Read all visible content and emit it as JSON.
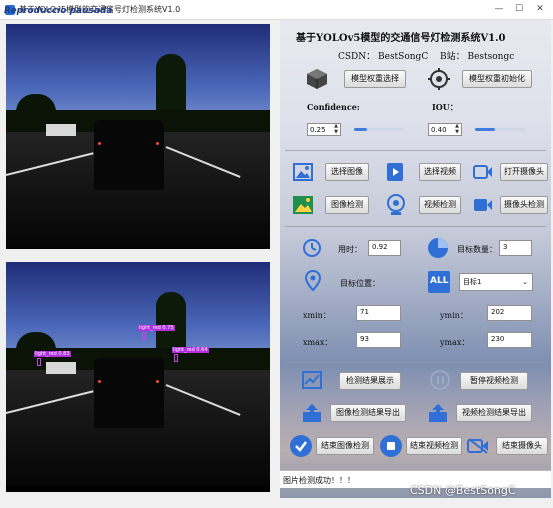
{
  "window": {
    "title": "基于YOLOv5模型的交通信号灯检测系统V1.0",
    "overlay_text": "Reproduccio pausada"
  },
  "detections": {
    "labels": [
      "light_red 0.75",
      "light_red 0.64",
      "light_red 0.83"
    ]
  },
  "panel": {
    "heading": "基于YOLOv5模型的交通信号灯检测系统V1.0",
    "credits_csdn": "CSDN：  BestSongC",
    "credits_bili": "B站：  Bestsongc",
    "model_select_label": "模型权重选择",
    "model_init_label": "模型权重初始化",
    "confidence_label": "Confidence:",
    "iou_label": "IOU：",
    "confidence_value": "0.25",
    "iou_value": "0.40",
    "confidence_level": 0.25,
    "iou_level": 0.4
  },
  "media": {
    "select_image": "选择图像",
    "select_video": "选择视频",
    "open_camera": "打开摄像头",
    "image_detect": "图像检测",
    "video_detect": "视频检测",
    "camera_detect": "摄像头检测"
  },
  "results": {
    "time_label": "用时：",
    "time_value": "0.92",
    "count_label": "目标数量：",
    "count_value": "3",
    "position_label": "目标位置：",
    "target_select": "目标1",
    "xmin_label": "xmin：",
    "xmin_value": "71",
    "ymin_label": "ymin：",
    "ymin_value": "202",
    "xmax_label": "xmax：",
    "xmax_value": "93",
    "ymax_label": "ymax：",
    "ymax_value": "230"
  },
  "actions": {
    "show_results": "检测结果展示",
    "pause_video": "暂停视频检测",
    "export_image": "图像检测结果导出",
    "export_video": "视频检测结果导出",
    "end_image": "结束图像检测",
    "end_video": "结束视频检测",
    "end_camera": "结束摄像头"
  },
  "status": {
    "message": "图片检测成功！！！"
  },
  "watermark": "CSDN @BestSongC",
  "colors": {
    "accent": "#3d7be0",
    "bbox": "#d040f0"
  }
}
